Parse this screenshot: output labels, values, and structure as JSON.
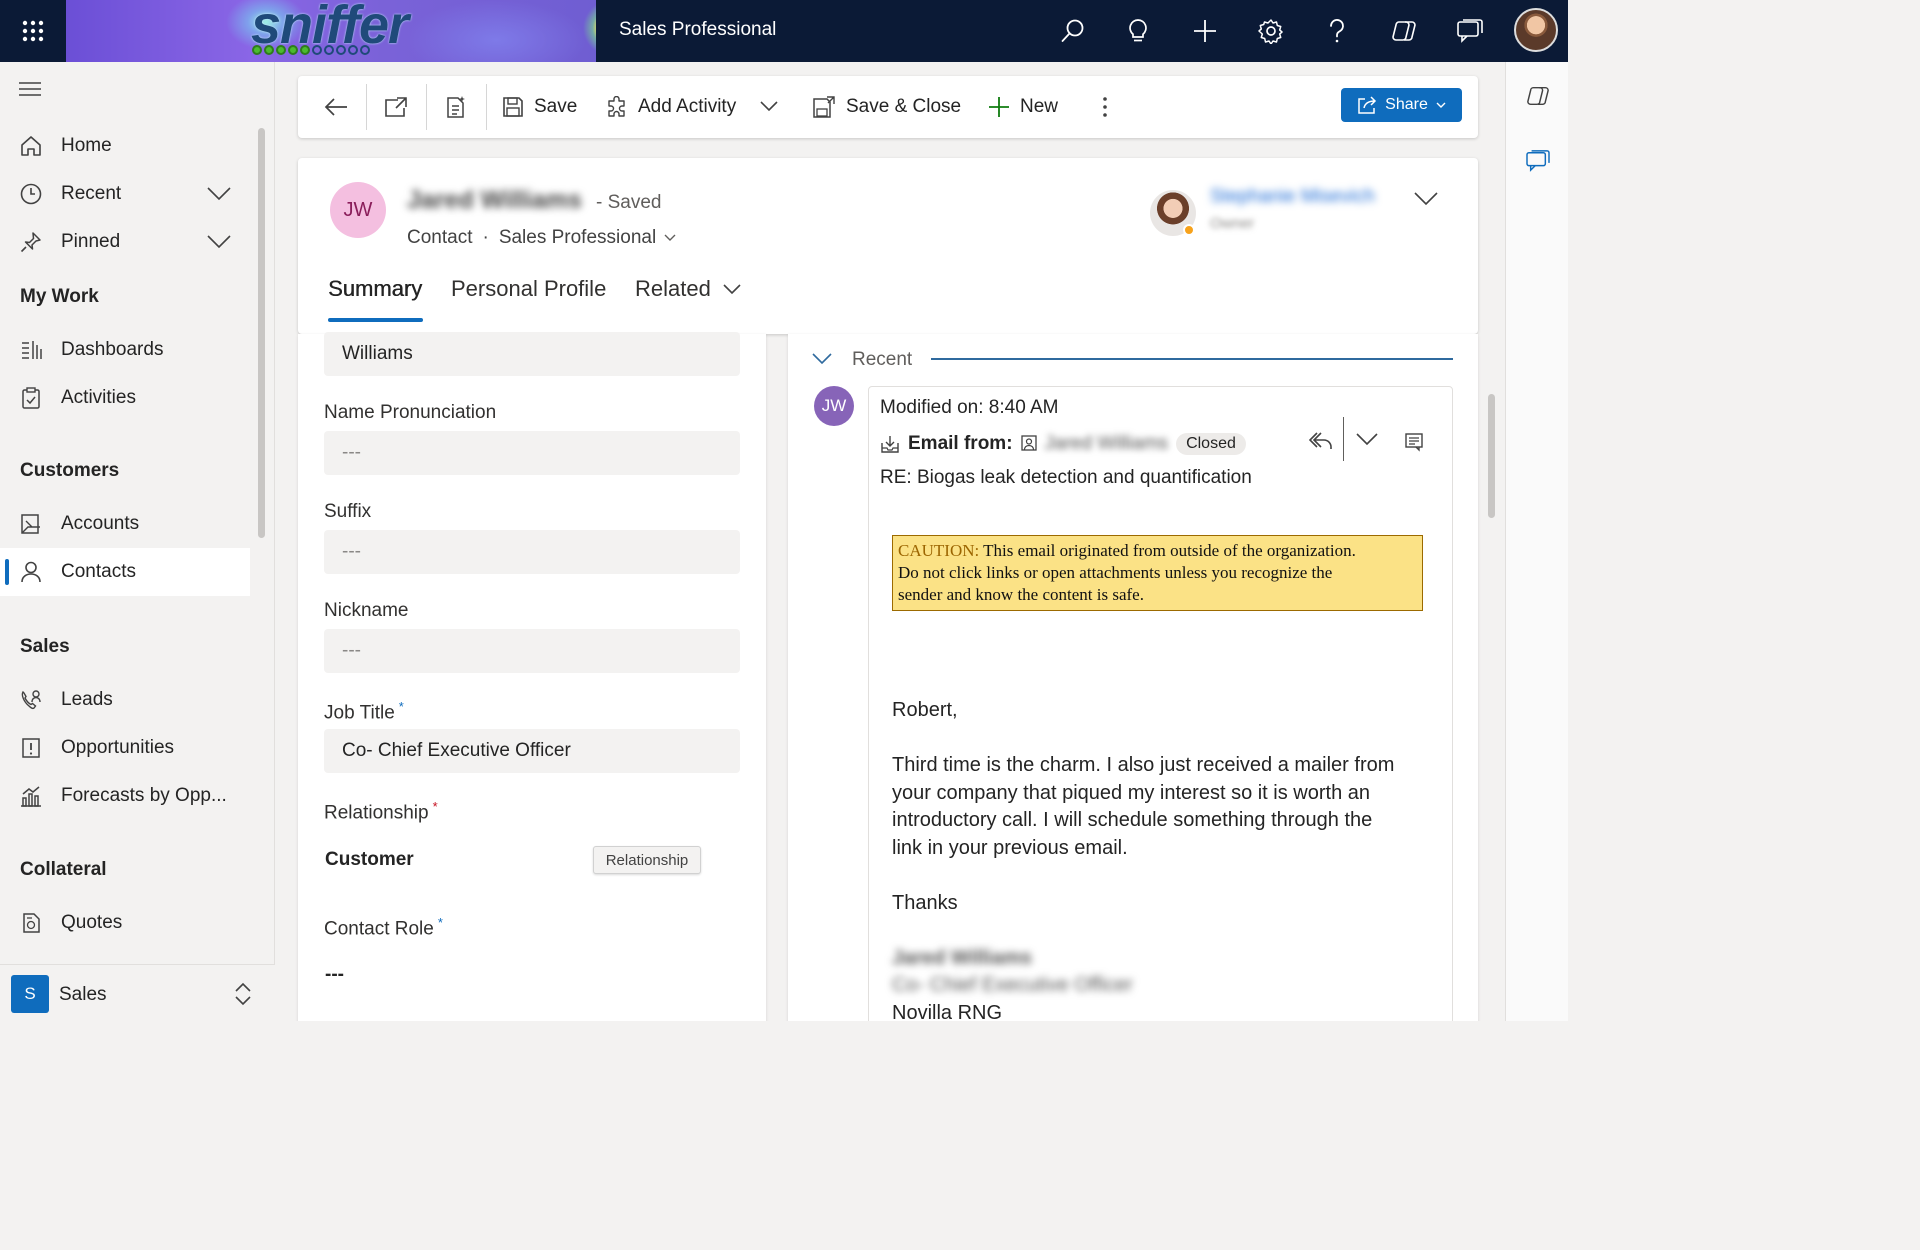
{
  "topbar": {
    "logo_text": "sniffer",
    "app_title": "Sales Professional",
    "icons": [
      "search-icon",
      "lightbulb-icon",
      "plus-icon",
      "gear-icon",
      "help-icon",
      "copilot-icon",
      "chat-icon"
    ]
  },
  "nav": {
    "items": [
      {
        "label": "Home",
        "icon": "home-icon"
      },
      {
        "label": "Recent",
        "icon": "clock-icon"
      },
      {
        "label": "Pinned",
        "icon": "pin-icon"
      }
    ],
    "my_work": {
      "title": "My Work",
      "items": [
        {
          "label": "Dashboards",
          "icon": "dashboard-icon"
        },
        {
          "label": "Activities",
          "icon": "clipboard-icon"
        }
      ]
    },
    "customers": {
      "title": "Customers",
      "items": [
        {
          "label": "Accounts",
          "icon": "building-icon"
        },
        {
          "label": "Contacts",
          "icon": "person-icon"
        }
      ]
    },
    "sales": {
      "title": "Sales",
      "items": [
        {
          "label": "Leads",
          "icon": "phone-person-icon"
        },
        {
          "label": "Opportunities",
          "icon": "opportunity-icon"
        },
        {
          "label": "Forecasts by Opp...",
          "icon": "forecast-icon"
        }
      ]
    },
    "collateral": {
      "title": "Collateral",
      "items": [
        {
          "label": "Quotes",
          "icon": "quote-icon"
        }
      ]
    },
    "area": {
      "badge": "S",
      "label": "Sales"
    }
  },
  "commandbar": {
    "save": "Save",
    "add_activity": "Add Activity",
    "save_close": "Save & Close",
    "new": "New",
    "share": "Share"
  },
  "record": {
    "initials": "JW",
    "name": "Jared Williams",
    "status": "- Saved",
    "entity": "Contact",
    "form": "Sales Professional",
    "owner_name": "Stephanie Misevich",
    "owner_role": "Owner",
    "tabs": [
      "Summary",
      "Personal Profile",
      "Related"
    ]
  },
  "form": {
    "last_name_value": "Williams",
    "name_pronunciation": {
      "label": "Name Pronunciation",
      "value": "---"
    },
    "suffix": {
      "label": "Suffix",
      "value": "---"
    },
    "nickname": {
      "label": "Nickname",
      "value": "---"
    },
    "job_title": {
      "label": "Job Title",
      "required": "*",
      "value": "Co- Chief Executive Officer"
    },
    "relationship": {
      "label": "Relationship",
      "required": "*",
      "value": "Customer",
      "tooltip": "Relationship"
    },
    "contact_role": {
      "label": "Contact Role",
      "required": "*",
      "value": "---"
    }
  },
  "timeline": {
    "section": "Recent",
    "avatar": "JW",
    "modified": "Modified on: 8:40 AM",
    "email_from_label": "Email from:",
    "sender": "Jared Williams",
    "status": "Closed",
    "subject": "RE: Biogas leak detection and quantification",
    "caution_label": "CAUTION:",
    "caution_line1": "This email originated from outside of the organization.",
    "caution_line2": "Do not click links or open attachments unless you recognize the",
    "caution_line3": "sender and know the content is safe.",
    "greeting": "Robert,",
    "body_line1": "Third time is the charm.  I also just received a mailer from",
    "body_line2": "your company that piqued my interest so it is worth an",
    "body_line3": "introductory call.  I will schedule something through the",
    "body_line4": "link in your previous email.",
    "signoff": "Thanks",
    "sig_name": "Jared Williams",
    "sig_title": "Co- Chief Executive Officer",
    "sig_company": "Novilla RNG"
  }
}
